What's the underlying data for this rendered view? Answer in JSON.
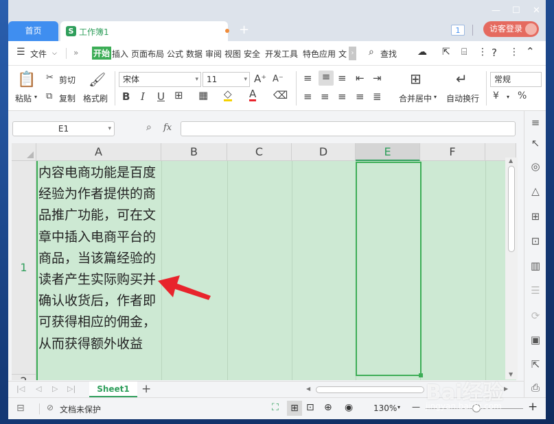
{
  "titlebar": {
    "home_tab": "首页",
    "doc_tab": "工作簿1",
    "doc_icon": "S",
    "new_tab": "+",
    "badge": "1",
    "login": "访客登录",
    "win_minimize": "—",
    "win_maximize": "☐",
    "win_close": "✕"
  },
  "menubar": {
    "file": "文件",
    "items": [
      "开始",
      "插入",
      "页面布局",
      "公式",
      "数据",
      "审阅",
      "视图",
      "安全",
      "开发工具",
      "特色应用",
      "文"
    ],
    "active": "开始",
    "search": "查找"
  },
  "ribbon": {
    "paste": "粘贴",
    "cut": "剪切",
    "copy": "复制",
    "format_painter": "格式刷",
    "font_name": "宋体",
    "font_size": "11",
    "bold": "B",
    "italic": "I",
    "underline": "U",
    "merge": "合并居中",
    "wrap": "自动换行",
    "number_format": "常规",
    "percent": "%"
  },
  "formula_bar": {
    "name_box": "E1",
    "fx": "fx",
    "formula": ""
  },
  "grid": {
    "columns": [
      "A",
      "B",
      "C",
      "D",
      "E",
      "F"
    ],
    "selected_column": "E",
    "rows": [
      "1",
      "2"
    ],
    "cell_A1": "内容电商功能是百度经验为作者提供的商品推广功能，可在文章中插入电商平台的商品，当该篇经验的读者产生实际购买并确认收货后，作者即可获得相应的佣金，从而获得额外收益"
  },
  "sheets": {
    "tabs": [
      "Sheet1"
    ],
    "add": "+"
  },
  "status": {
    "protect": "文档未保护",
    "zoom": "130%",
    "minus": "—",
    "plus": "+"
  },
  "watermark": {
    "brand": "Bai经验",
    "url": "jingyan.baidu.com"
  },
  "colors": {
    "accent_green": "#3cad56",
    "selection_fill": "#cde9d3",
    "tab_blue": "#3f8ef0",
    "login_red": "#e56a5f",
    "arrow_red": "#e8242c"
  }
}
